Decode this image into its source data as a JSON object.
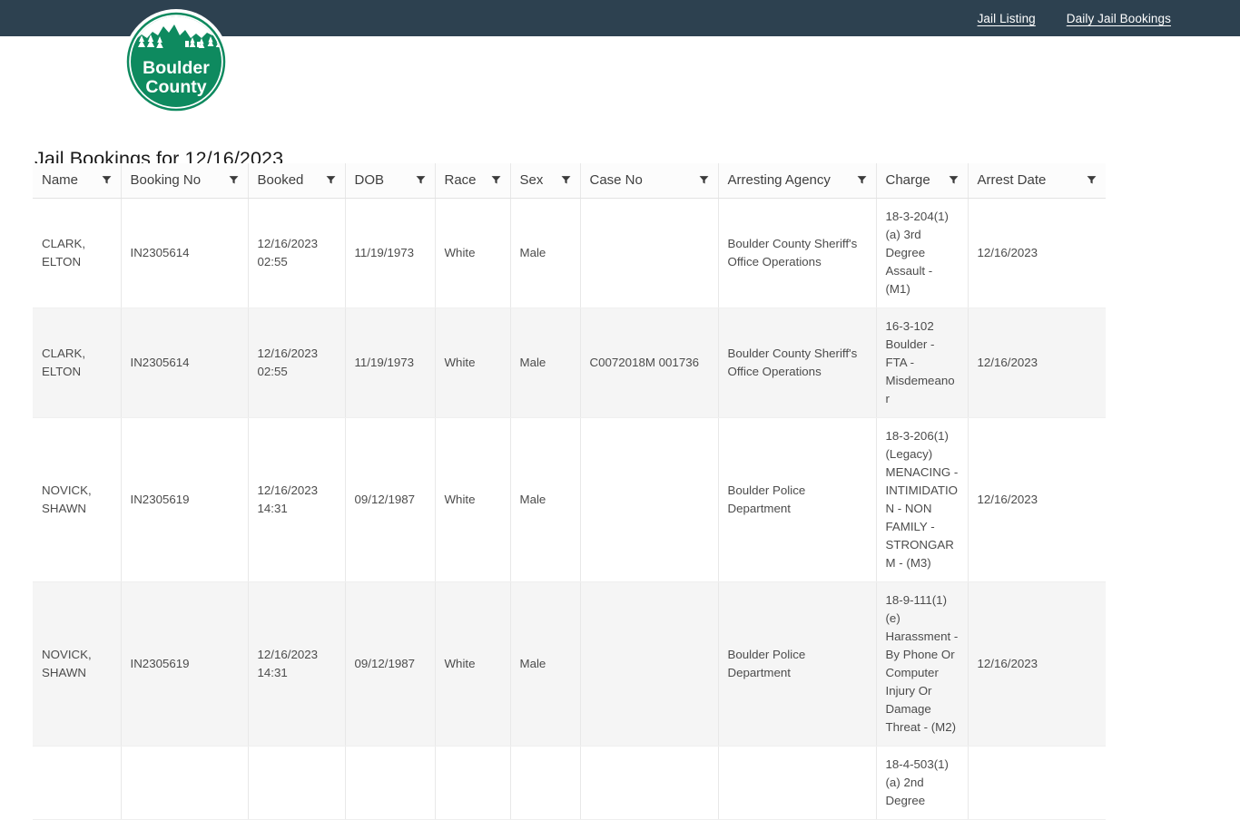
{
  "topbar": {
    "background_color": "#2d4150",
    "links": [
      {
        "label": "Jail Listing",
        "name": "jail-listing"
      },
      {
        "label": "Daily Jail Bookings",
        "name": "daily-jail-bookings"
      }
    ]
  },
  "logo": {
    "line1": "Boulder",
    "line2": "County",
    "color": "#0e8a5f",
    "alt": "Boulder County logo"
  },
  "page": {
    "title": "Jail Bookings for 12/16/2023"
  },
  "table": {
    "columns": [
      {
        "label": "Name",
        "key": "name"
      },
      {
        "label": "Booking No",
        "key": "booking"
      },
      {
        "label": "Booked",
        "key": "booked"
      },
      {
        "label": "DOB",
        "key": "dob"
      },
      {
        "label": "Race",
        "key": "race"
      },
      {
        "label": "Sex",
        "key": "sex"
      },
      {
        "label": "Case No",
        "key": "case"
      },
      {
        "label": "Arresting Agency",
        "key": "agency"
      },
      {
        "label": "Charge",
        "key": "charge"
      },
      {
        "label": "Arrest Date",
        "key": "arrest"
      }
    ],
    "rows": [
      {
        "name": "CLARK, ELTON",
        "booking": "IN2305614",
        "booked": "12/16/2023 02:55",
        "dob": "11/19/1973",
        "race": "White",
        "sex": "Male",
        "case": "",
        "agency": "Boulder County Sheriff's Office Operations",
        "charge": "18-3-204(1)(a) 3rd Degree Assault - (M1)",
        "arrest": "12/16/2023"
      },
      {
        "name": "CLARK, ELTON",
        "booking": "IN2305614",
        "booked": "12/16/2023 02:55",
        "dob": "11/19/1973",
        "race": "White",
        "sex": "Male",
        "case": "C0072018M 001736",
        "agency": "Boulder County Sheriff's Office Operations",
        "charge": "16-3-102 Boulder - FTA - Misdemeanor",
        "arrest": "12/16/2023"
      },
      {
        "name": "NOVICK, SHAWN",
        "booking": "IN2305619",
        "booked": "12/16/2023 14:31",
        "dob": "09/12/1987",
        "race": "White",
        "sex": "Male",
        "case": "",
        "agency": "Boulder Police Department",
        "charge": "18-3-206(1) (Legacy) MENACING - INTIMIDATION - NON FAMILY - STRONGARM - (M3)",
        "arrest": "12/16/2023"
      },
      {
        "name": "NOVICK, SHAWN",
        "booking": "IN2305619",
        "booked": "12/16/2023 14:31",
        "dob": "09/12/1987",
        "race": "White",
        "sex": "Male",
        "case": "",
        "agency": "Boulder Police Department",
        "charge": "18-9-111(1)(e) Harassment - By Phone Or Computer Injury Or Damage Threat - (M2)",
        "arrest": "12/16/2023"
      },
      {
        "name": "",
        "booking": "",
        "booked": "",
        "dob": "",
        "race": "",
        "sex": "",
        "case": "",
        "agency": "",
        "charge": "18-4-503(1)(a) 2nd Degree",
        "arrest": ""
      }
    ]
  },
  "icons": {
    "filter": "filter-funnel-icon"
  }
}
